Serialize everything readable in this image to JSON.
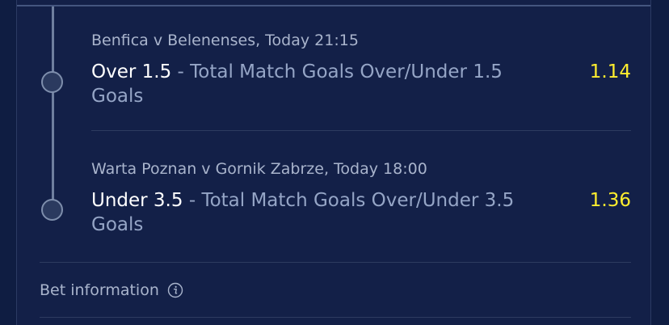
{
  "legs": [
    {
      "event": "Benfica v Belenenses, Today 21:15",
      "selection": "Over 1.5",
      "separator": " - ",
      "market": "Total Match Goals Over/Under 1.5 Goals",
      "odds": "1.14"
    },
    {
      "event": "Warta Poznan v Gornik Zabrze, Today 18:00",
      "selection": "Under 3.5",
      "separator": " - ",
      "market": "Total Match Goals Over/Under 3.5 Goals",
      "odds": "1.36"
    }
  ],
  "bet_info": {
    "label": "Bet information",
    "icon": "info-circle-icon"
  },
  "colors": {
    "background": "#0f1d42",
    "card": "#132048",
    "odds": "#ffee2e",
    "selection": "#ffffff",
    "market": "#95a5c6",
    "muted_text": "#a9b4cc"
  }
}
